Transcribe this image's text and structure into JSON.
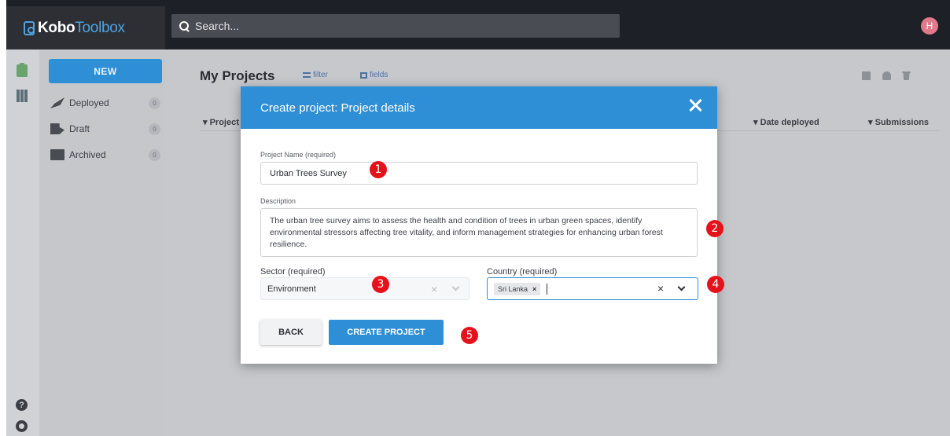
{
  "app": {
    "logo_kobo": "Kobo",
    "logo_toolbox": "Toolbox",
    "search_placeholder": "Search...",
    "avatar_initial": "H"
  },
  "sidebar": {
    "new_label": "NEW",
    "items": [
      {
        "label": "Deployed",
        "count": "0",
        "icon": "deployed-icon"
      },
      {
        "label": "Draft",
        "count": "0",
        "icon": "draft-icon"
      },
      {
        "label": "Archived",
        "count": "0",
        "icon": "archived-icon"
      }
    ]
  },
  "rail": {
    "icons": [
      "clipboard-icon",
      "library-icon",
      "help-icon",
      "github-icon"
    ]
  },
  "main": {
    "title": "My Projects",
    "filter_label": "filter",
    "fields_label": "fields",
    "columns": [
      "Project n",
      "Date deployed",
      "Submissions"
    ],
    "action_icons": [
      "archive-icon",
      "share-icon",
      "delete-icon"
    ]
  },
  "modal": {
    "title": "Create project: Project details",
    "name_label": "Project Name (required)",
    "name_value": "Urban Trees Survey",
    "description_label": "Description",
    "description_value": "The urban tree survey aims to assess the health and condition of trees in urban green spaces, identify environmental stressors affecting tree vitality, and inform management strategies for enhancing urban forest resilience.",
    "sector_label": "Sector (required)",
    "sector_value": "Environment",
    "country_label": "Country (required)",
    "country_tag": "Sri Lanka",
    "back_label": "BACK",
    "create_label": "CREATE PROJECT"
  },
  "annotations": [
    "1",
    "2",
    "3",
    "4",
    "5"
  ],
  "colors": {
    "accent": "#2f8fd6",
    "topbar": "#1e2027",
    "badge": "#e5121b"
  }
}
